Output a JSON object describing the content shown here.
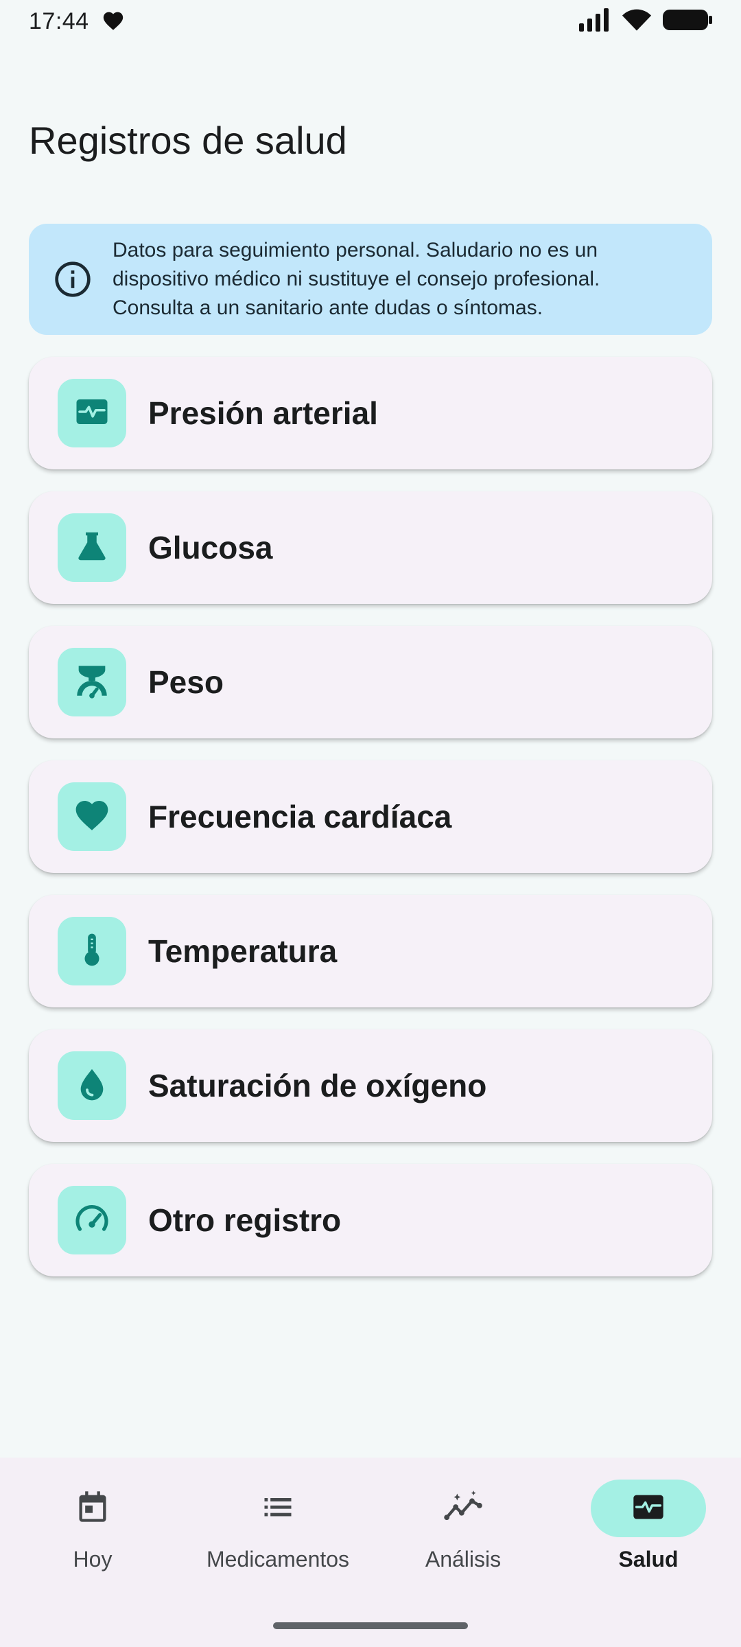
{
  "status_bar": {
    "time": "17:44"
  },
  "header": {
    "title": "Registros de salud"
  },
  "info_banner": {
    "icon": "info-icon",
    "text": "Datos para seguimiento personal. Saludario no es un dispositivo médico ni sustituye el consejo profesional. Consulta a un sanitario ante dudas o síntomas."
  },
  "records": [
    {
      "label": "Presión arterial",
      "icon": "monitor-heart-icon"
    },
    {
      "label": "Glucosa",
      "icon": "flask-icon"
    },
    {
      "label": "Peso",
      "icon": "scale-icon"
    },
    {
      "label": "Frecuencia cardíaca",
      "icon": "heart-icon"
    },
    {
      "label": "Temperatura",
      "icon": "thermometer-icon"
    },
    {
      "label": "Saturación de oxígeno",
      "icon": "water-drop-icon"
    },
    {
      "label": "Otro registro",
      "icon": "speed-gauge-icon"
    }
  ],
  "nav": {
    "items": [
      {
        "label": "Hoy",
        "icon": "calendar-icon"
      },
      {
        "label": "Medicamentos",
        "icon": "list-icon"
      },
      {
        "label": "Análisis",
        "icon": "analytics-icon"
      },
      {
        "label": "Salud",
        "icon": "monitor-heart-icon"
      }
    ],
    "active": "Salud"
  },
  "colors": {
    "accent_container": "#A4F0E4",
    "accent_icon": "#0E8477",
    "banner_bg": "#C2E7FB",
    "card_bg": "#F6F1F8",
    "page_bg": "#F3F8F8"
  }
}
